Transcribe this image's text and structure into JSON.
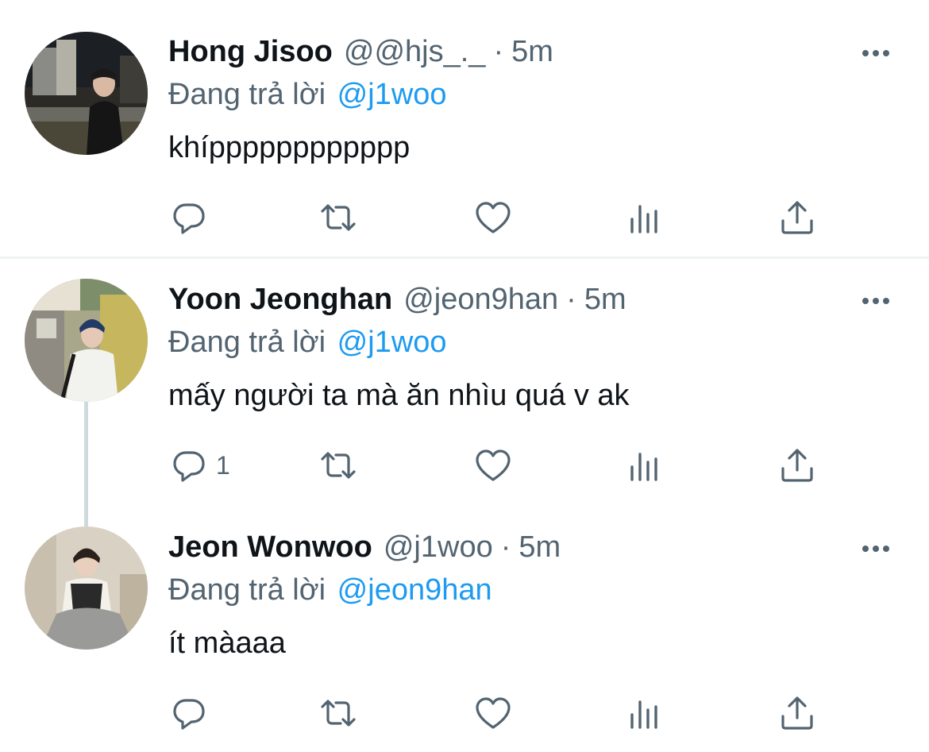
{
  "tweets": [
    {
      "name": "Hong Jisoo",
      "handle": "@@hjs_._",
      "dot": "·",
      "time": "5m",
      "reply_prefix": "Đang trả lời",
      "reply_to": "@j1woo",
      "text": "khípppppppppppp",
      "reply_count": ""
    },
    {
      "name": "Yoon Jeonghan",
      "handle": "@jeon9han",
      "dot": "·",
      "time": "5m",
      "reply_prefix": "Đang trả lời",
      "reply_to": "@j1woo",
      "text": "mấy người ta mà ăn nhìu quá v ak",
      "reply_count": "1"
    },
    {
      "name": "Jeon Wonwoo",
      "handle": "@j1woo",
      "dot": "·",
      "time": "5m",
      "reply_prefix": "Đang trả lời",
      "reply_to": "@jeon9han",
      "text": "ít màaaa",
      "reply_count": ""
    }
  ],
  "icons": [
    "reply-icon",
    "retweet-icon",
    "like-icon",
    "views-icon",
    "share-icon",
    "more-icon"
  ],
  "colors": {
    "text": "#0f1419",
    "secondary": "#536471",
    "mention": "#1d9bf0",
    "divider": "#eff3f4"
  }
}
